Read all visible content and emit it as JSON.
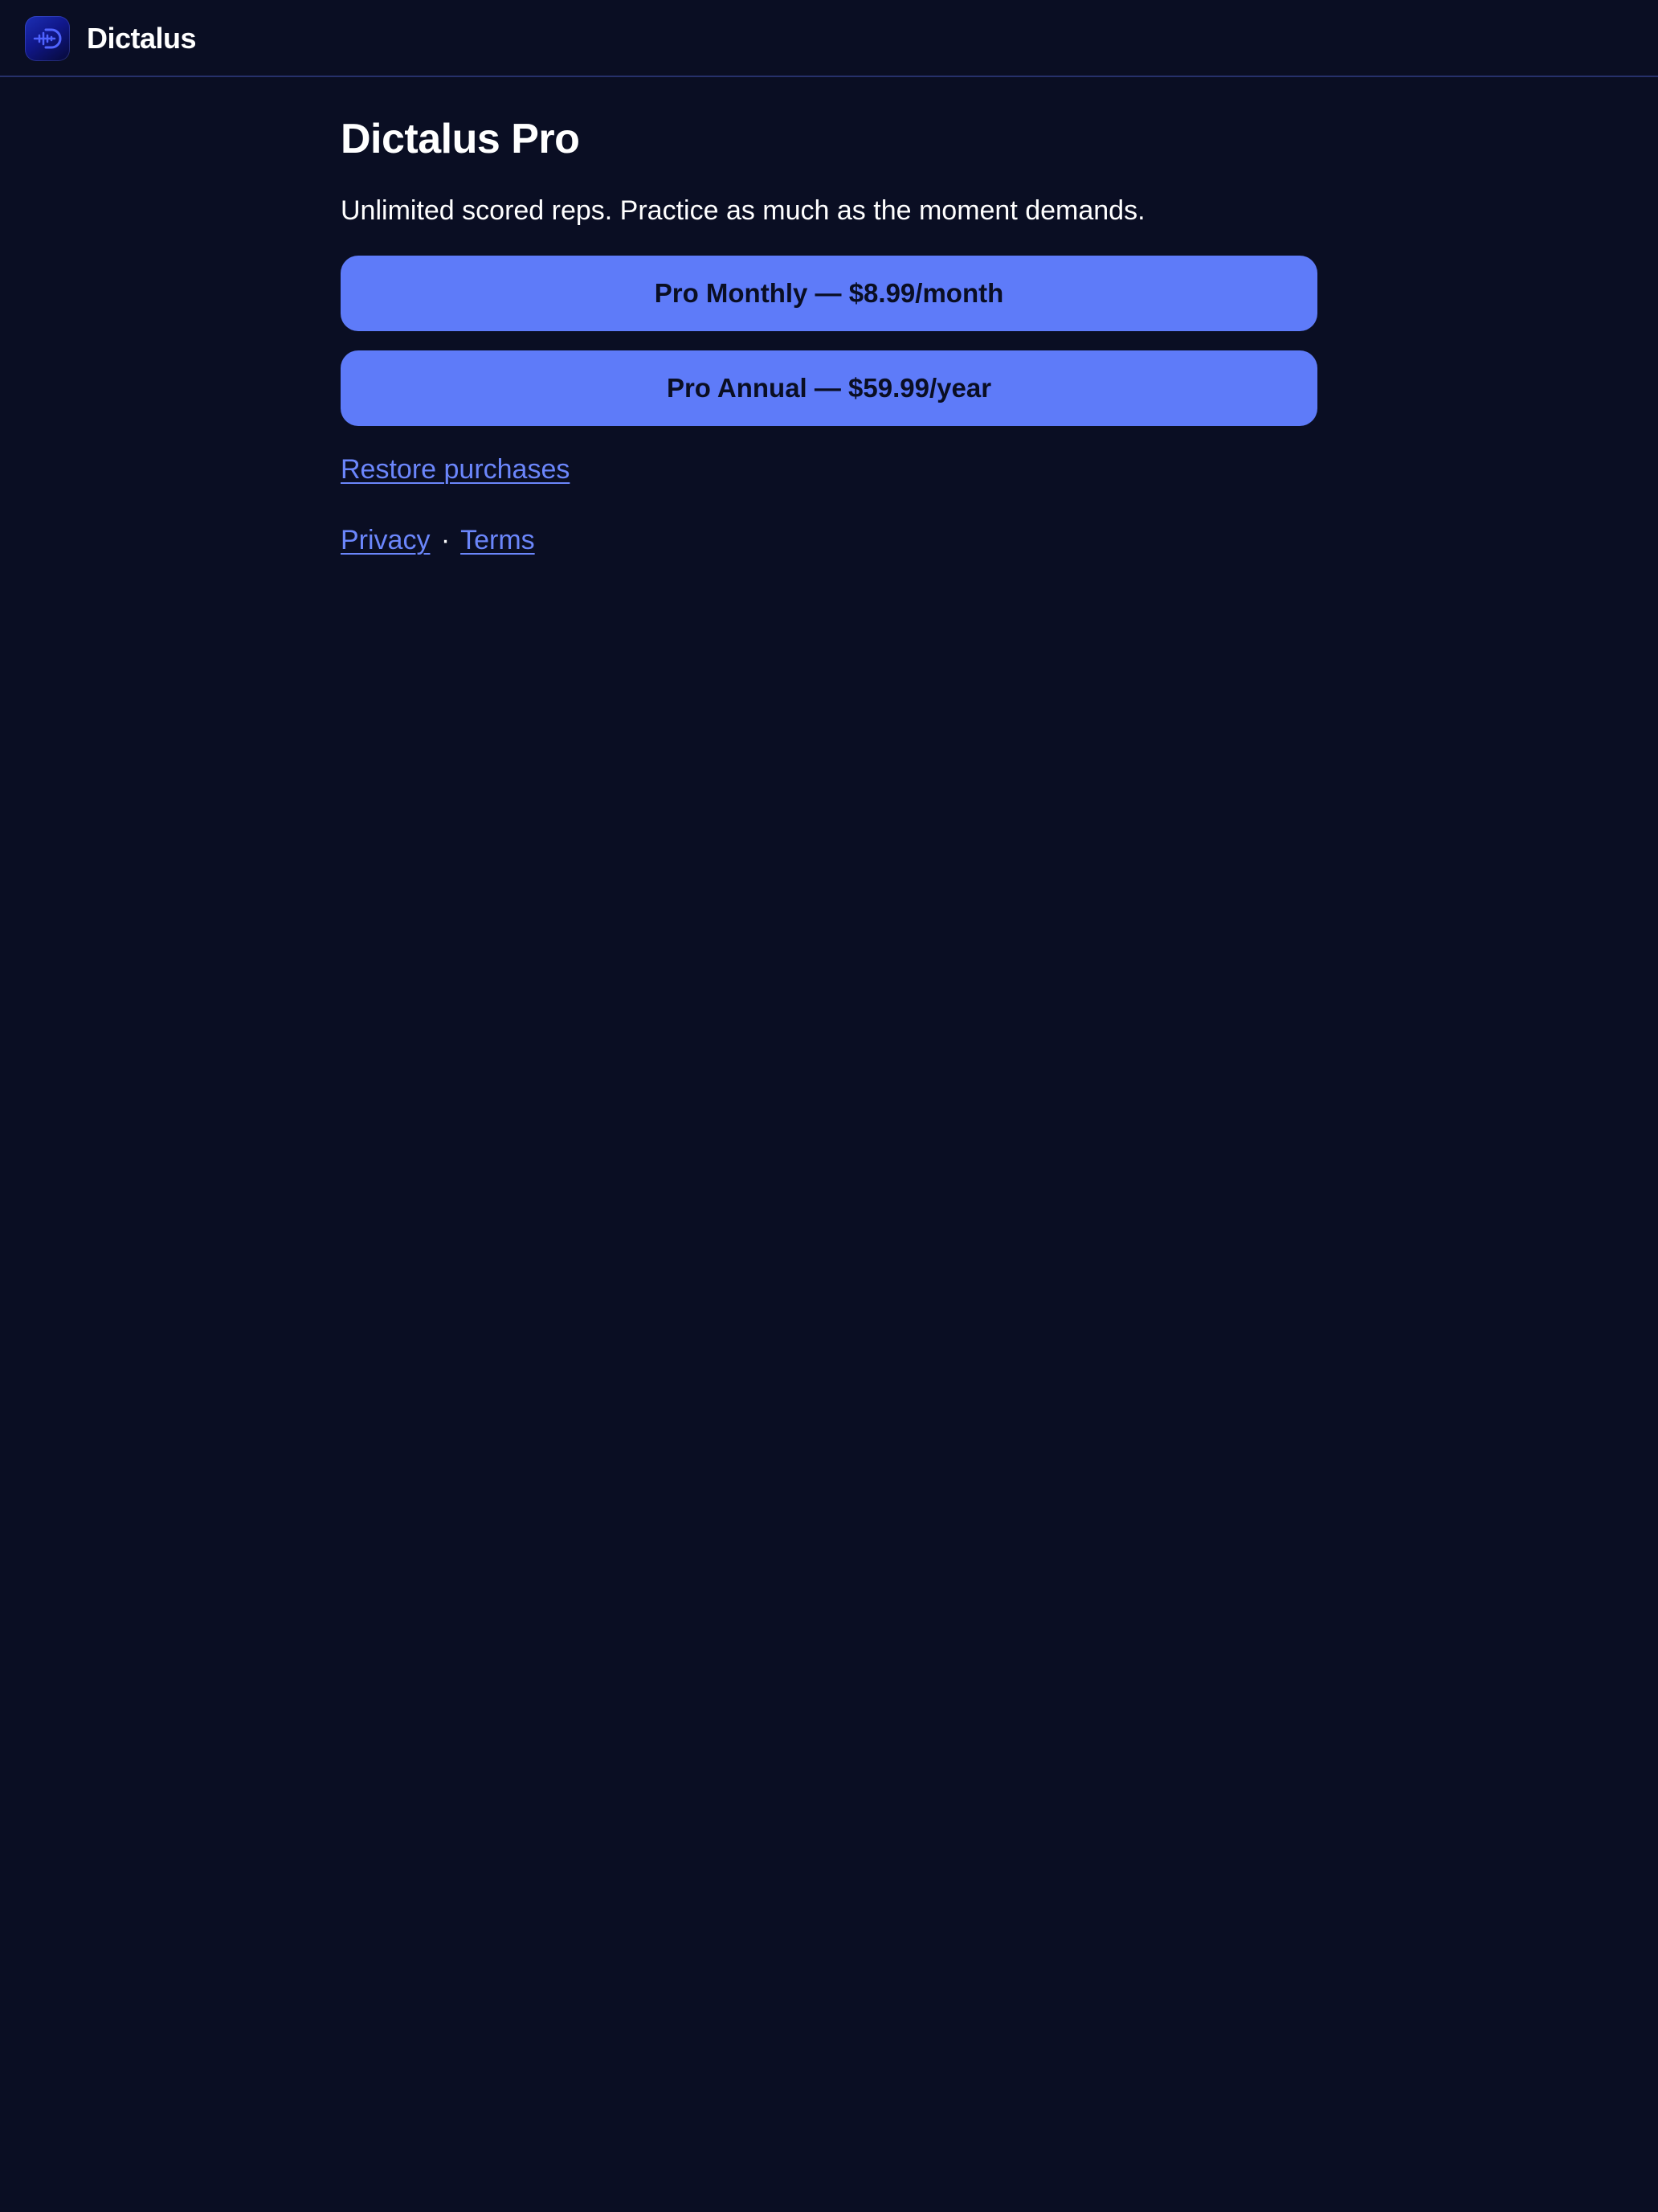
{
  "header": {
    "app_name": "Dictalus",
    "logo_icon": "dictalus-logo-icon"
  },
  "main": {
    "title": "Dictalus Pro",
    "tagline": "Unlimited scored reps. Practice as much as the moment demands.",
    "plans": [
      {
        "label": "Pro Monthly — $8.99/month"
      },
      {
        "label": "Pro Annual — $59.99/year"
      }
    ],
    "restore_label": "Restore purchases",
    "legal": {
      "privacy_label": "Privacy",
      "separator": "·",
      "terms_label": "Terms"
    }
  },
  "colors": {
    "background": "#0a0e23",
    "accent": "#5e7bf9",
    "link": "#6b86fb",
    "divider": "#26306a",
    "text": "#ffffff"
  }
}
